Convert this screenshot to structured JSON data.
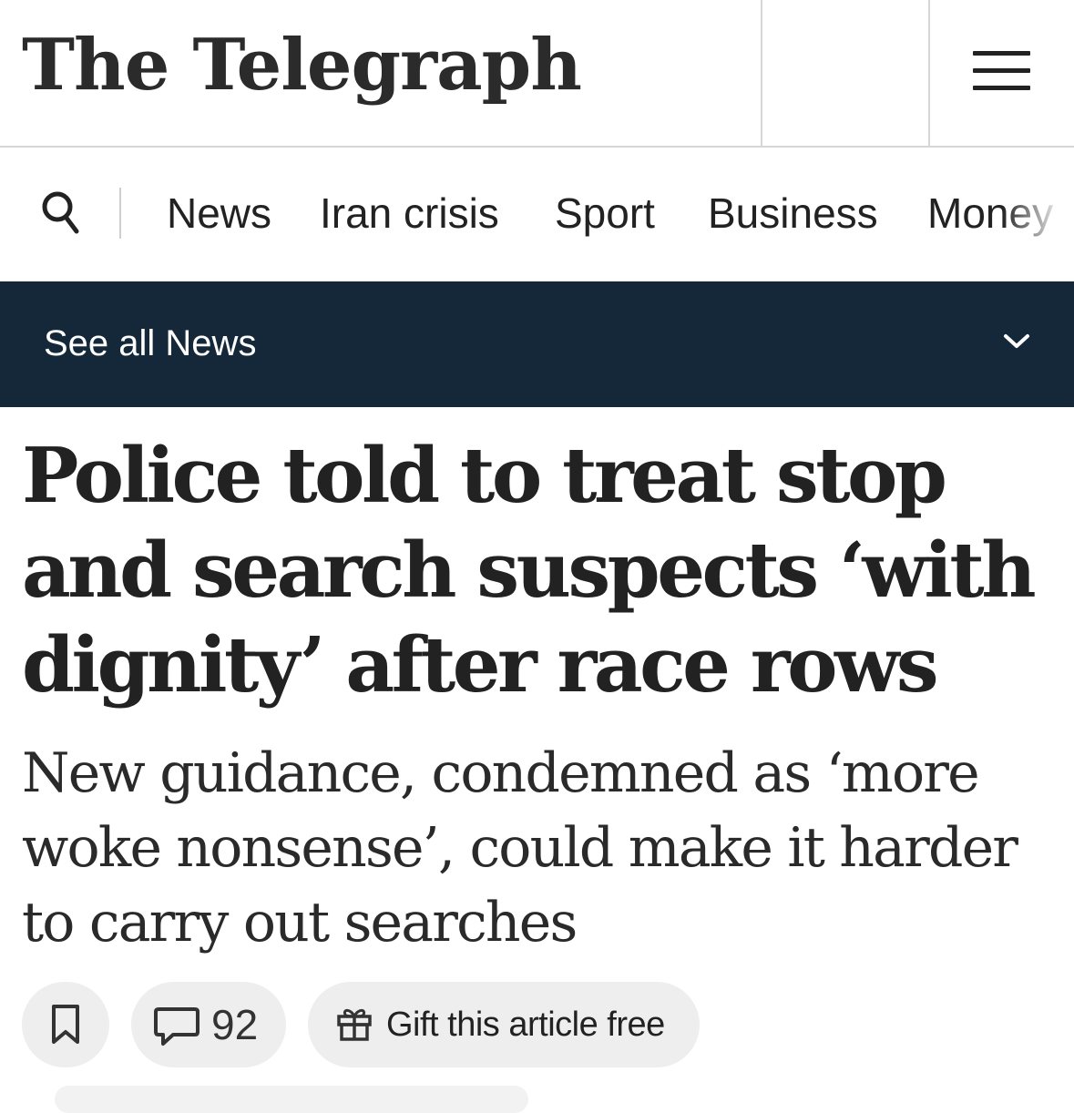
{
  "masthead": {
    "logo_text": "The Telegraph",
    "menu_icon": "hamburger-menu-icon"
  },
  "nav": {
    "search_icon": "search-icon",
    "items": [
      {
        "label": "News"
      },
      {
        "label": "Iran crisis"
      },
      {
        "label": "Sport"
      },
      {
        "label": "Business"
      },
      {
        "label": "Money"
      }
    ]
  },
  "section": {
    "label": "See all News",
    "icon": "chevron-down-icon",
    "background": "#15283a"
  },
  "article": {
    "headline": "Police told to treat stop and search suspects ‘with dignity’ after race rows",
    "standfirst": "New guidance, condemned as ‘more woke nonsense’, could make it harder to carry out searches"
  },
  "actions": {
    "bookmark_icon": "bookmark-icon",
    "comment_icon": "comment-icon",
    "comment_count": "92",
    "gift_icon": "gift-icon",
    "gift_label": "Gift this article free"
  }
}
